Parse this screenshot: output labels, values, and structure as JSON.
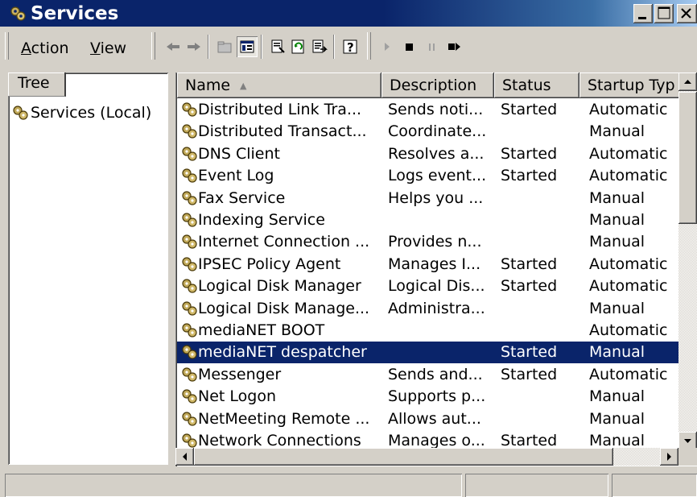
{
  "window": {
    "title": "Services",
    "icon": "services-gears-icon",
    "title_color": "#0a246a"
  },
  "menubar": {
    "items": [
      {
        "label": "Action",
        "underline": "A",
        "rest": "ction"
      },
      {
        "label": "View",
        "underline": "V",
        "rest": "iew"
      }
    ]
  },
  "toolbar": {
    "icons": [
      "back-arrow-icon",
      "forward-arrow-icon",
      "up-folder-icon",
      "show-tree-icon",
      "properties-icon",
      "refresh-icon",
      "export-list-icon",
      "help-icon",
      "start-service-icon",
      "stop-service-icon",
      "pause-service-icon",
      "restart-service-icon"
    ]
  },
  "tree": {
    "tab_label": "Tree",
    "root_label": "Services (Local)"
  },
  "list": {
    "columns": [
      "Name",
      "Description",
      "Status",
      "Startup Typ"
    ],
    "sort_indicator": "▲",
    "selected_color": "#0a246a",
    "rows": [
      {
        "name": "Distributed Link Tra...",
        "description": "Sends noti...",
        "status": "Started",
        "startup": "Automatic"
      },
      {
        "name": "Distributed Transact...",
        "description": "Coordinate...",
        "status": "",
        "startup": "Manual"
      },
      {
        "name": "DNS Client",
        "description": "Resolves a...",
        "status": "Started",
        "startup": "Automatic"
      },
      {
        "name": "Event Log",
        "description": "Logs event...",
        "status": "Started",
        "startup": "Automatic"
      },
      {
        "name": "Fax Service",
        "description": "Helps you ...",
        "status": "",
        "startup": "Manual"
      },
      {
        "name": "Indexing Service",
        "description": "",
        "status": "",
        "startup": "Manual"
      },
      {
        "name": "Internet Connection ...",
        "description": "Provides n...",
        "status": "",
        "startup": "Manual"
      },
      {
        "name": "IPSEC Policy Agent",
        "description": "Manages I...",
        "status": "Started",
        "startup": "Automatic"
      },
      {
        "name": "Logical Disk Manager",
        "description": "Logical Dis...",
        "status": "Started",
        "startup": "Automatic"
      },
      {
        "name": "Logical Disk Manage...",
        "description": "Administra...",
        "status": "",
        "startup": "Manual"
      },
      {
        "name": "mediaNET BOOT",
        "description": "",
        "status": "",
        "startup": "Automatic"
      },
      {
        "name": "mediaNET despatcher",
        "description": "",
        "status": "Started",
        "startup": "Manual",
        "selected": true
      },
      {
        "name": "Messenger",
        "description": "Sends and...",
        "status": "Started",
        "startup": "Automatic"
      },
      {
        "name": "Net Logon",
        "description": "Supports p...",
        "status": "",
        "startup": "Manual"
      },
      {
        "name": "NetMeeting Remote ...",
        "description": "Allows aut...",
        "status": "",
        "startup": "Manual"
      },
      {
        "name": "Network Connections",
        "description": "Manages o...",
        "status": "Started",
        "startup": "Manual"
      }
    ]
  }
}
